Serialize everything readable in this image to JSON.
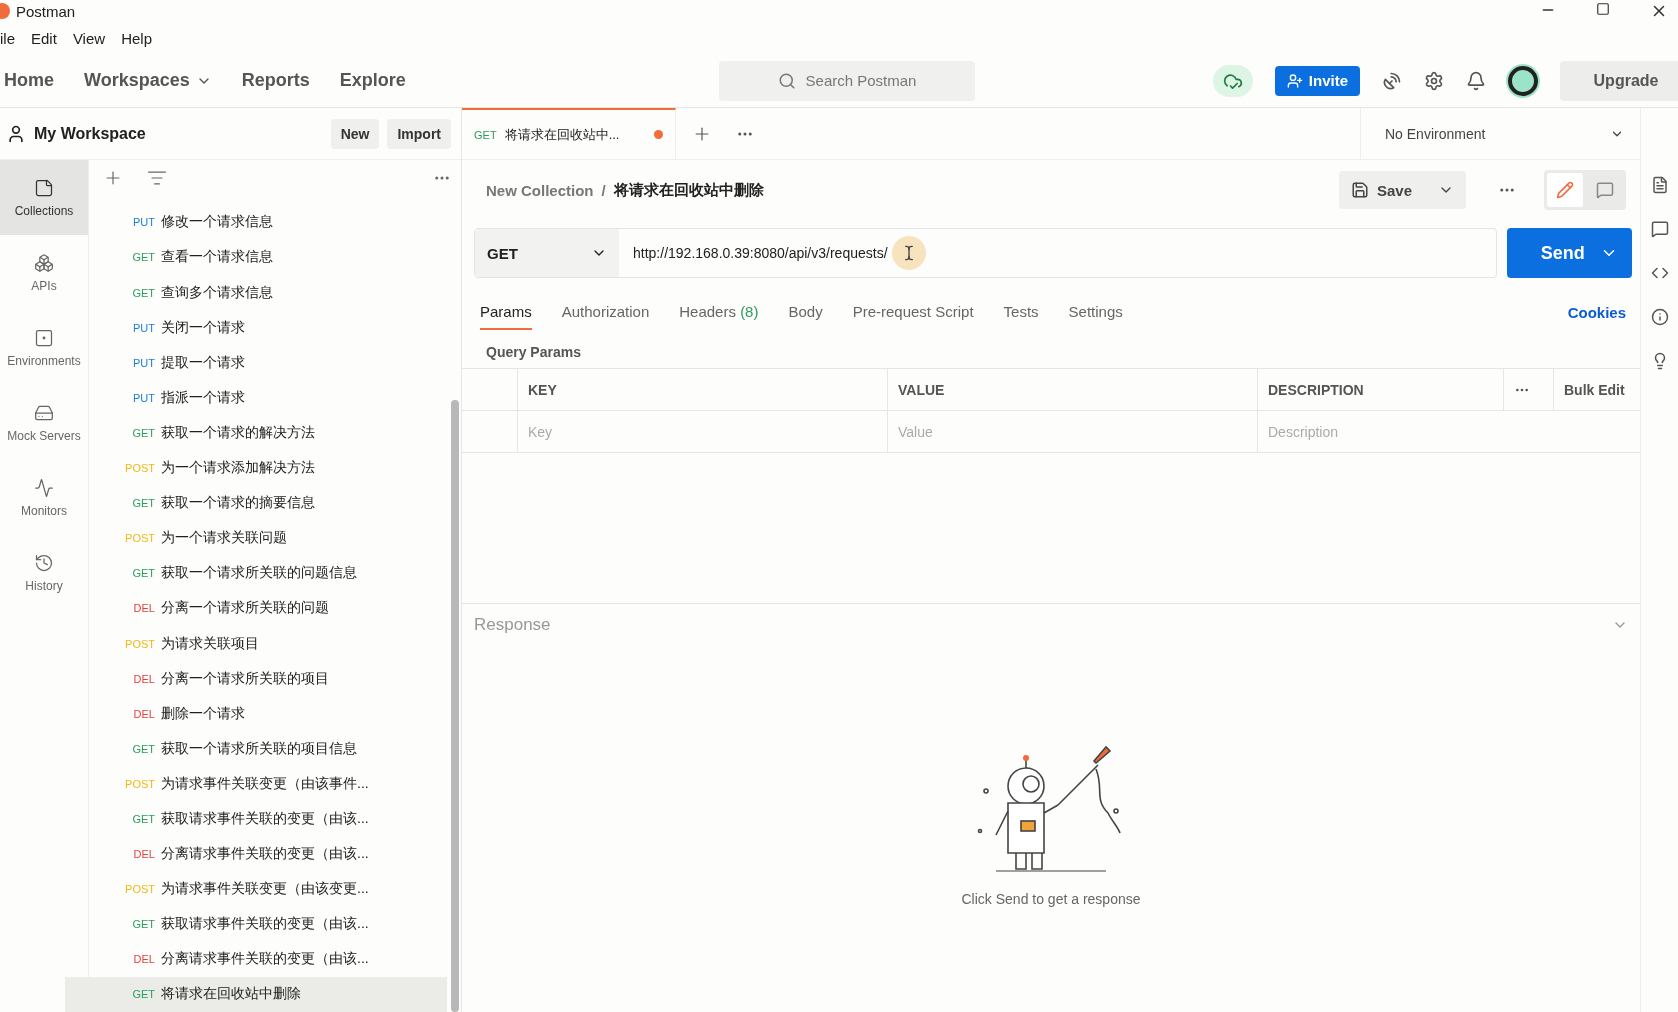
{
  "window": {
    "title": "Postman"
  },
  "menu": [
    "ile",
    "Edit",
    "View",
    "Help"
  ],
  "nav": [
    {
      "label": "Home",
      "dropdown": false
    },
    {
      "label": "Workspaces",
      "dropdown": true
    },
    {
      "label": "Reports",
      "dropdown": false
    },
    {
      "label": "Explore",
      "dropdown": false
    }
  ],
  "search": {
    "placeholder": "Search Postman"
  },
  "invite": "Invite",
  "upgrade": "Upgrade",
  "workspace": {
    "name": "My Workspace",
    "buttons": [
      "New",
      "Import"
    ]
  },
  "sidebar_nav": [
    {
      "label": "Collections",
      "selected": true
    },
    {
      "label": "APIs",
      "selected": false
    },
    {
      "label": "Environments",
      "selected": false
    },
    {
      "label": "Mock Servers",
      "selected": false
    },
    {
      "label": "Monitors",
      "selected": false
    },
    {
      "label": "History",
      "selected": false
    }
  ],
  "requests": [
    {
      "method": "PUT",
      "name": "修改一个请求信息",
      "selected": false
    },
    {
      "method": "GET",
      "name": "查看一个请求信息",
      "selected": false
    },
    {
      "method": "GET",
      "name": "查询多个请求信息",
      "selected": false
    },
    {
      "method": "PUT",
      "name": "关闭一个请求",
      "selected": false
    },
    {
      "method": "PUT",
      "name": "提取一个请求",
      "selected": false
    },
    {
      "method": "PUT",
      "name": "指派一个请求",
      "selected": false
    },
    {
      "method": "GET",
      "name": "获取一个请求的解决方法",
      "selected": false
    },
    {
      "method": "POST",
      "name": "为一个请求添加解决方法",
      "selected": false
    },
    {
      "method": "GET",
      "name": "获取一个请求的摘要信息",
      "selected": false
    },
    {
      "method": "POST",
      "name": "为一个请求关联问题",
      "selected": false
    },
    {
      "method": "GET",
      "name": "获取一个请求所关联的问题信息",
      "selected": false
    },
    {
      "method": "DEL",
      "name": "分离一个请求所关联的问题",
      "selected": false
    },
    {
      "method": "POST",
      "name": "为请求关联项目",
      "selected": false
    },
    {
      "method": "DEL",
      "name": "分离一个请求所关联的项目",
      "selected": false
    },
    {
      "method": "DEL",
      "name": "删除一个请求",
      "selected": false
    },
    {
      "method": "GET",
      "name": "获取一个请求所关联的项目信息",
      "selected": false
    },
    {
      "method": "POST",
      "name": "为请求事件关联变更（由该事件...",
      "selected": false
    },
    {
      "method": "GET",
      "name": "获取请求事件关联的变更（由该...",
      "selected": false
    },
    {
      "method": "DEL",
      "name": "分离请求事件关联的变更（由该...",
      "selected": false
    },
    {
      "method": "POST",
      "name": "为请求事件关联变更（由该变更...",
      "selected": false
    },
    {
      "method": "GET",
      "name": "获取请求事件关联的变更（由该...",
      "selected": false
    },
    {
      "method": "DEL",
      "name": "分离请求事件关联的变更（由该...",
      "selected": false
    },
    {
      "method": "GET",
      "name": "将请求在回收站中删除",
      "selected": true
    }
  ],
  "tabs": [
    {
      "method": "GET",
      "title": "将请求在回收站中...",
      "unsaved": true,
      "selected": true
    }
  ],
  "environment": "No Environment",
  "breadcrumb": {
    "collection": "New Collection",
    "separator": "/",
    "request": "将请求在回收站中删除"
  },
  "save": "Save",
  "request": {
    "method": "GET",
    "url": "http://192.168.0.39:8080/api/v3/requests/",
    "send": "Send"
  },
  "request_tabs": [
    {
      "label": "Params",
      "selected": true
    },
    {
      "label": "Authorization",
      "selected": false
    },
    {
      "label": "Headers",
      "count": "(8)",
      "selected": false
    },
    {
      "label": "Body",
      "selected": false
    },
    {
      "label": "Pre-request Script",
      "selected": false
    },
    {
      "label": "Tests",
      "selected": false
    },
    {
      "label": "Settings",
      "selected": false
    }
  ],
  "cookies": "Cookies",
  "query_params": {
    "title": "Query Params",
    "columns": [
      "KEY",
      "VALUE",
      "DESCRIPTION"
    ],
    "bulk_edit": "Bulk Edit",
    "placeholders": [
      "Key",
      "Value",
      "Description"
    ]
  },
  "response": {
    "title": "Response",
    "empty_text": "Click Send to get a response"
  }
}
